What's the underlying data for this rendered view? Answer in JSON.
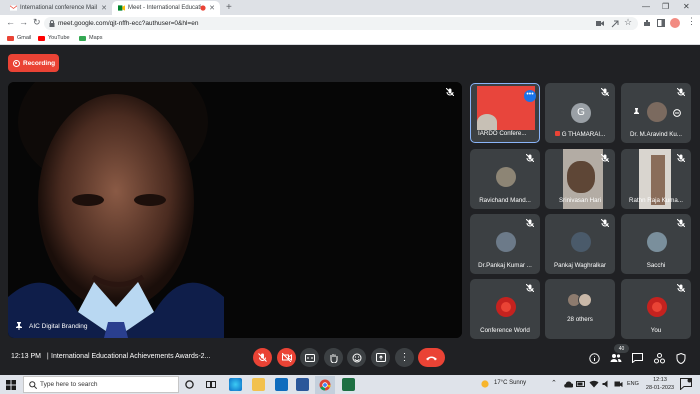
{
  "browser": {
    "tabs": [
      {
        "title": "International conference Mail",
        "active": false
      },
      {
        "title": "Meet - International Educati",
        "active": true
      }
    ],
    "url": "meet.google.com/qjt-nffh-ecc?authuser=0&hl=en",
    "bookmarks": [
      {
        "label": "Gmail",
        "color": "#ea4335"
      },
      {
        "label": "YouTube",
        "color": "#ff0000"
      },
      {
        "label": "Maps",
        "color": "#34a853"
      }
    ]
  },
  "meet": {
    "recording_label": "Recording",
    "main_speaker": "AIC Digital Branding",
    "participants": [
      {
        "name": "IARDO Confere...",
        "kind": "slide"
      },
      {
        "name": "G THAMARAI...",
        "kind": "initial",
        "initial": "G",
        "avatar_color": "#9aa0a6"
      },
      {
        "name": "Dr. M.Aravind Ku...",
        "kind": "photo"
      },
      {
        "name": "Ravichand Mand...",
        "kind": "photo"
      },
      {
        "name": "Srinivasan Hari",
        "kind": "video"
      },
      {
        "name": "Rathn Raja Kuma...",
        "kind": "video"
      },
      {
        "name": "Dr.Pankaj Kumar ...",
        "kind": "photo"
      },
      {
        "name": "Pankaj Waghralkar",
        "kind": "photo"
      },
      {
        "name": "Sacchi",
        "kind": "photo"
      },
      {
        "name": "Conference World",
        "kind": "logo"
      },
      {
        "name": "28 others",
        "kind": "others"
      },
      {
        "name": "You",
        "kind": "logo"
      }
    ],
    "time": "12:13 PM",
    "separator": "|",
    "meeting_title": "International Educational Achievements Awards-2...",
    "participant_count": "40"
  },
  "taskbar": {
    "search_placeholder": "Type here to search",
    "weather": "17°C  Sunny",
    "language": "ENG",
    "time": "12:13",
    "date": "28-01-2023"
  },
  "colors": {
    "accent_red": "#ea4335",
    "meet_bg": "#202124",
    "tile_bg": "#3c4043"
  }
}
